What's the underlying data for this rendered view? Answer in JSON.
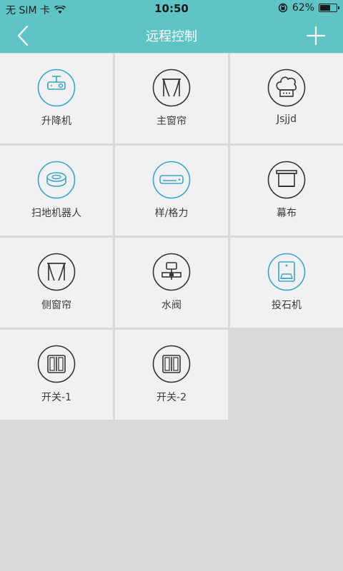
{
  "status": {
    "carrier": "无 SIM 卡",
    "time": "10:50",
    "battery": "62%",
    "battery_level": 0.62
  },
  "nav": {
    "title": "远程控制",
    "back_icon": "chevron-left-icon",
    "add_icon": "plus-icon"
  },
  "devices": [
    {
      "label": "升降机",
      "icon": "projector-lift-icon",
      "color": "#3aa6c8"
    },
    {
      "label": "主窗帘",
      "icon": "curtain-icon",
      "color": "#333333"
    },
    {
      "label": "Jsjjd",
      "icon": "chef-hat-icon",
      "color": "#333333"
    },
    {
      "label": "扫地机器人",
      "icon": "robot-vacuum-icon",
      "color": "#3aa6c8"
    },
    {
      "label": "样/格力",
      "icon": "set-top-box-icon",
      "color": "#3aa6c8"
    },
    {
      "label": "幕布",
      "icon": "projection-screen-icon",
      "color": "#333333"
    },
    {
      "label": "侧窗帘",
      "icon": "curtain-icon",
      "color": "#333333"
    },
    {
      "label": "水阀",
      "icon": "water-valve-icon",
      "color": "#333333"
    },
    {
      "label": "投石机",
      "icon": "ac-unit-icon",
      "color": "#3aa6c8"
    },
    {
      "label": "开关-1",
      "icon": "switch-icon",
      "color": "#333333"
    },
    {
      "label": "开关-2",
      "icon": "switch-icon",
      "color": "#333333"
    }
  ]
}
